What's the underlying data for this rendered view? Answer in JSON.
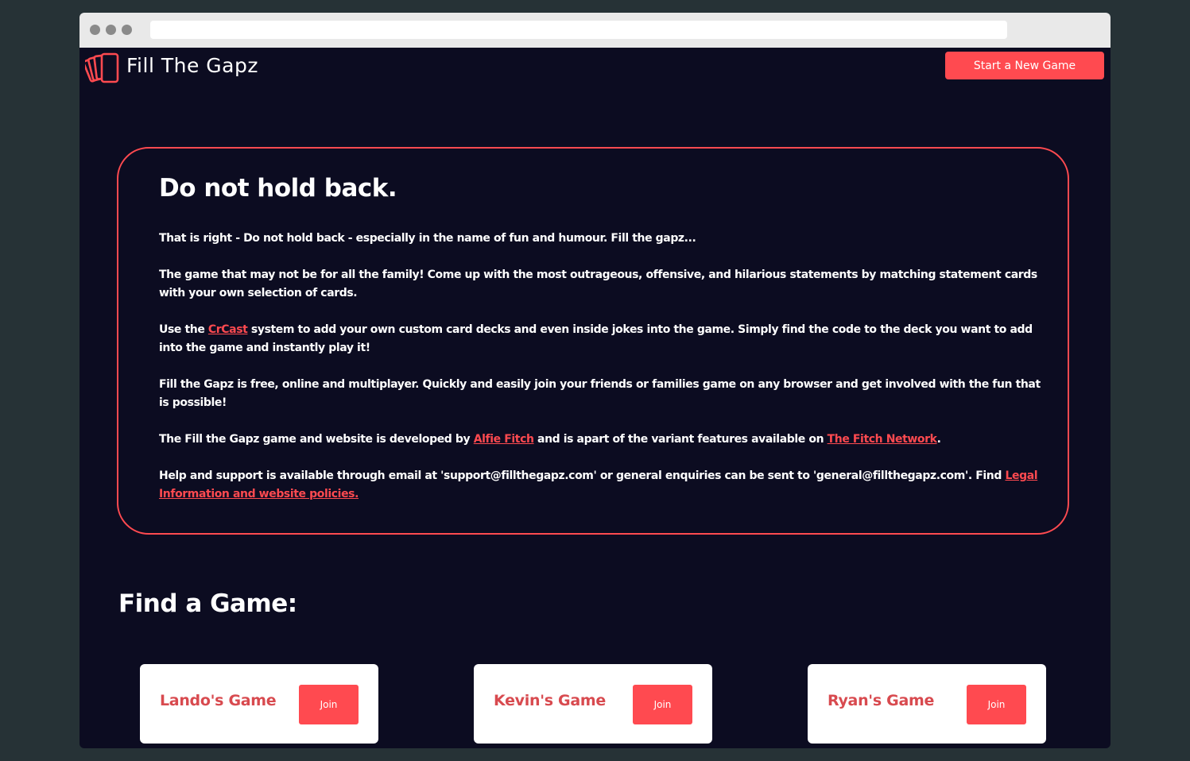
{
  "header": {
    "app_title": "Fill The Gapz",
    "new_game_label": "Start a New Game",
    "logo_icon": "cards-icon"
  },
  "about": {
    "title": "Do not hold back.",
    "p1": "That is right - Do not hold back - especially in the name of fun and humour. Fill the gapz...",
    "p2": "The game that may not be for all the family! Come up with the most outrageous, offensive, and hilarious statements by matching statement cards with your own selection of cards.",
    "p3_before": "Use the ",
    "p3_link": "CrCast",
    "p3_after": " system to add your own custom card decks and even inside jokes into the game. Simply find the code to the deck you want to add into the game and instantly play it!",
    "p4": "Fill the Gapz is free, online and multiplayer. Quickly and easily join your friends or families game on any browser and get involved with the fun that is possible!",
    "p5_before": "The Fill the Gapz game and website is developed by ",
    "p5_link1": "Alfie Fitch",
    "p5_middle": " and is apart of the variant features available on ",
    "p5_link2": "The Fitch Network",
    "p5_after": ".",
    "p6_before": "Help and support is available through email at 'support@fillthegapz.com' or general enquiries can be sent to 'general@fillthegapz.com'. Find ",
    "p6_link": "Legal Information and website policies."
  },
  "find": {
    "title": "Find a Game:",
    "games": [
      {
        "name": "Lando's Game",
        "join_label": "Join"
      },
      {
        "name": "Kevin's Game",
        "join_label": "Join"
      },
      {
        "name": "Ryan's Game",
        "join_label": "Join"
      }
    ]
  },
  "colors": {
    "accent": "#ff4a50",
    "background": "#0c0c21",
    "game_name": "#d84a4f",
    "outer": "#263236"
  }
}
